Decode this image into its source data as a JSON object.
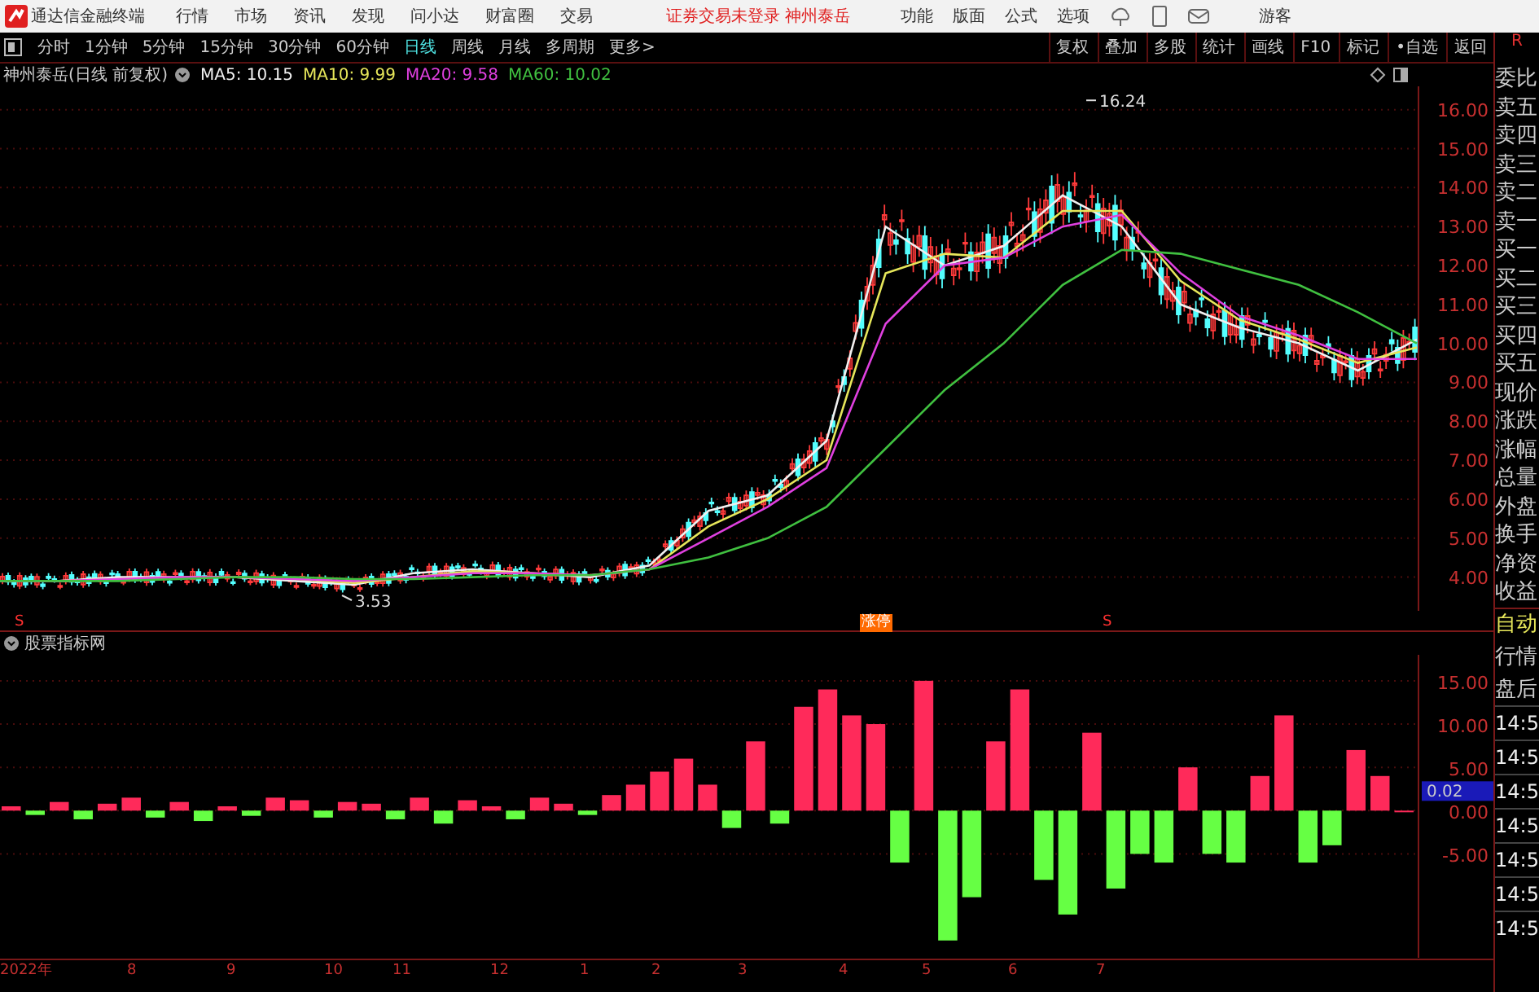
{
  "app": {
    "title": "通达信金融终端",
    "menu": [
      "行情",
      "市场",
      "资讯",
      "发现",
      "问小达",
      "财富圈",
      "交易"
    ],
    "status": "证券交易未登录 神州泰岳",
    "tools": [
      "功能",
      "版面",
      "公式",
      "选项"
    ],
    "user": "游客"
  },
  "periods": [
    {
      "label": "分时",
      "selected": false
    },
    {
      "label": "1分钟",
      "selected": false
    },
    {
      "label": "5分钟",
      "selected": false
    },
    {
      "label": "15分钟",
      "selected": false
    },
    {
      "label": "30分钟",
      "selected": false
    },
    {
      "label": "60分钟",
      "selected": false
    },
    {
      "label": "日线",
      "selected": true
    },
    {
      "label": "周线",
      "selected": false
    },
    {
      "label": "月线",
      "selected": false
    },
    {
      "label": "多周期",
      "selected": false
    },
    {
      "label": "更多>",
      "selected": false
    }
  ],
  "actions": [
    "复权",
    "叠加",
    "多股",
    "统计",
    "画线",
    "F10",
    "标记",
    "•自选",
    "返回"
  ],
  "price_panel": {
    "title": "神州泰岳(日线 前复权)",
    "legend": [
      {
        "label": "MA5: 10.15",
        "color": "#f0f0f0"
      },
      {
        "label": "MA10: 9.99",
        "color": "#e6e65a"
      },
      {
        "label": "MA20: 9.58",
        "color": "#e040e0"
      },
      {
        "label": "MA60: 10.02",
        "color": "#40c040"
      }
    ],
    "price_ticks": [
      "16.00",
      "15.00",
      "14.00",
      "13.00",
      "12.00",
      "11.00",
      "10.00",
      "9.00",
      "8.00",
      "7.00",
      "6.00",
      "5.00",
      "4.00"
    ],
    "extremes": [
      "16.24",
      "3.53"
    ],
    "signals": [
      {
        "kind": "s",
        "text": "S"
      },
      {
        "kind": "tag",
        "text": "涨停"
      },
      {
        "kind": "s",
        "text": "S"
      }
    ]
  },
  "indicator_panel": {
    "current_value": "0.02",
    "chart_data": {
      "type": "bar",
      "ylim": [
        -17,
        18
      ],
      "grid": true,
      "stacked": true,
      "yticks": [
        {
          "value": -5,
          "label": "-5.00"
        },
        {
          "value": 0,
          "label": "0.00"
        },
        {
          "value": 5,
          "label": "5.00"
        },
        {
          "value": 10,
          "label": "10.00"
        },
        {
          "value": 15,
          "label": "15.00"
        }
      ],
      "series": [
        {
          "name": "股票指标网",
          "color": "#ff2a5a",
          "values": [
            0.5,
            null,
            1,
            null,
            0.8,
            1.5,
            null,
            1,
            null,
            0.5,
            null,
            1.5,
            1.2,
            null,
            1,
            0.8,
            null,
            1.5,
            null,
            1.2,
            0.5,
            null,
            1.5,
            0.8,
            null,
            1.8,
            3,
            4.5,
            6,
            3,
            null,
            8,
            null,
            12,
            14,
            11,
            10,
            null,
            15,
            null,
            null,
            8,
            14,
            null,
            null,
            9,
            null,
            null,
            null,
            5,
            null,
            null,
            4,
            11,
            null,
            null,
            7,
            4,
            0
          ]
        },
        {
          "color": "#66ff44",
          "values": [
            null,
            -0.5,
            null,
            -1,
            null,
            null,
            -0.8,
            null,
            -1.2,
            null,
            -0.6,
            null,
            null,
            -0.8,
            null,
            null,
            -1,
            null,
            -1.5,
            null,
            null,
            -1,
            null,
            null,
            -0.5,
            null,
            null,
            null,
            null,
            null,
            -2,
            null,
            -1.5,
            null,
            null,
            null,
            null,
            -6,
            null,
            -15,
            -10,
            null,
            null,
            -8,
            -12,
            null,
            -9,
            -5,
            -6,
            null,
            -5,
            -6,
            null,
            null,
            -6,
            -4,
            null,
            null,
            null
          ]
        }
      ]
    }
  },
  "date_axis": [
    "2022年",
    "8",
    "9",
    "10",
    "11",
    "12",
    "1",
    "2",
    "3",
    "4",
    "5",
    "6",
    "7"
  ],
  "side_labels": [
    "委比",
    "卖五",
    "卖四",
    "卖三",
    "卖二",
    "卖一",
    "买一",
    "买二",
    "买三",
    "买四",
    "买五",
    "现价",
    "涨跌",
    "涨幅",
    "总量",
    "外盘",
    "换手",
    "净资",
    "收益"
  ],
  "side_header": "R",
  "side_modes": [
    {
      "label": "自动",
      "selected": true
    },
    {
      "label": "行情",
      "selected": false
    },
    {
      "label": "盘后",
      "selected": false
    }
  ],
  "side_times": [
    "14:5",
    "14:5",
    "14:5",
    "14:5",
    "14:5",
    "14:5",
    "14:5"
  ]
}
